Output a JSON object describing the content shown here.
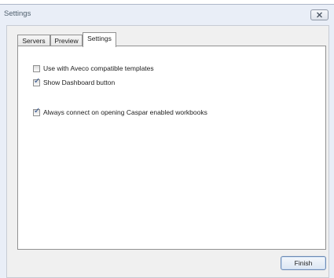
{
  "window": {
    "title": "Settings",
    "close_icon": "close-icon"
  },
  "tabs": [
    {
      "label": "Servers",
      "active": false
    },
    {
      "label": "Preview",
      "active": false
    },
    {
      "label": "Settings",
      "active": true
    }
  ],
  "settings": {
    "options": [
      {
        "label": "Use with Aveco compatible templates",
        "checked": false
      },
      {
        "label": "Show Dashboard button",
        "checked": true
      },
      {
        "label": "Always connect on opening Caspar enabled workbooks",
        "checked": true
      }
    ]
  },
  "footer": {
    "finish_label": "Finish"
  },
  "colors": {
    "checkmark": "#2b4f8c",
    "frame": "#e9eef7"
  }
}
